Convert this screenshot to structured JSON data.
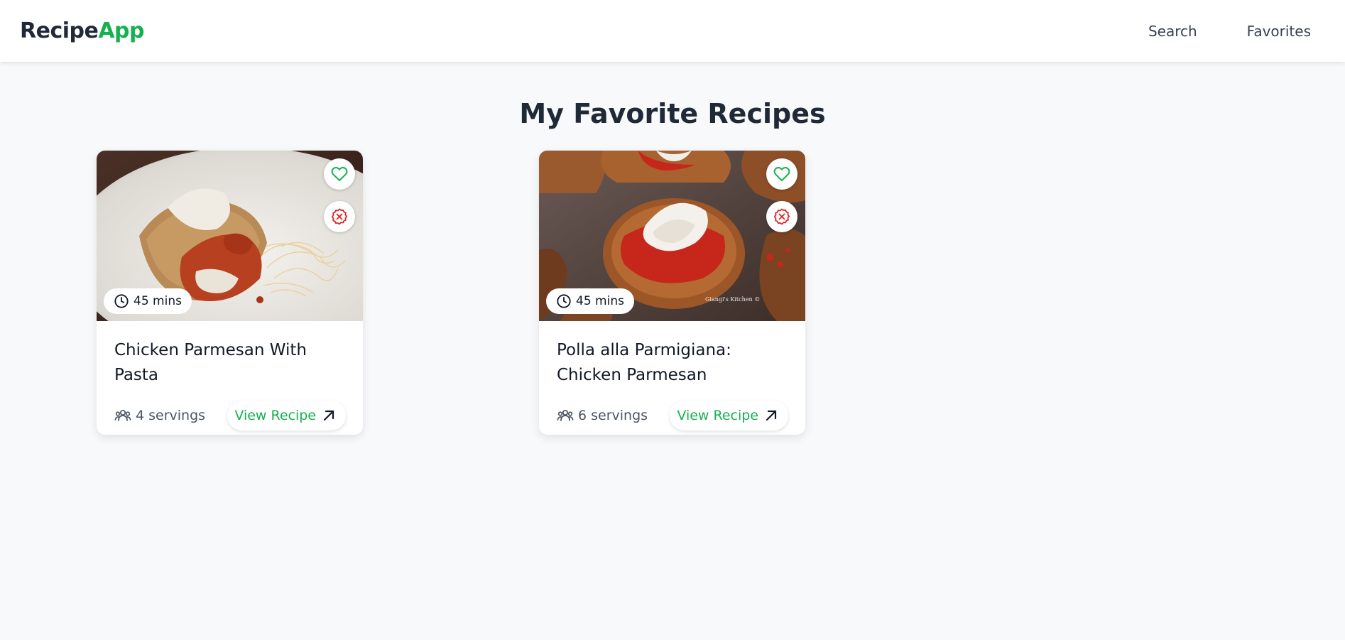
{
  "header": {
    "logo_main": "Recipe",
    "logo_accent": "App",
    "nav": {
      "search": "Search",
      "favorites": "Favorites"
    }
  },
  "page": {
    "title": "My Favorite Recipes"
  },
  "recipes": [
    {
      "title": "Chicken Parmesan With Pasta",
      "time": "45 mins",
      "servings": "4 servings",
      "view_label": "View Recipe"
    },
    {
      "title": "Polla alla Parmigiana: Chicken Parmesan",
      "time": "45 mins",
      "servings": "6 servings",
      "view_label": "View Recipe",
      "image_watermark": "Giangi's Kitchen ©"
    }
  ],
  "colors": {
    "accent": "#16b14f",
    "remove": "#e02424",
    "background": "#f8f9fb"
  },
  "icons": [
    "heart-icon",
    "remove-circle-icon",
    "clock-icon",
    "users-icon",
    "arrow-up-right-icon"
  ]
}
